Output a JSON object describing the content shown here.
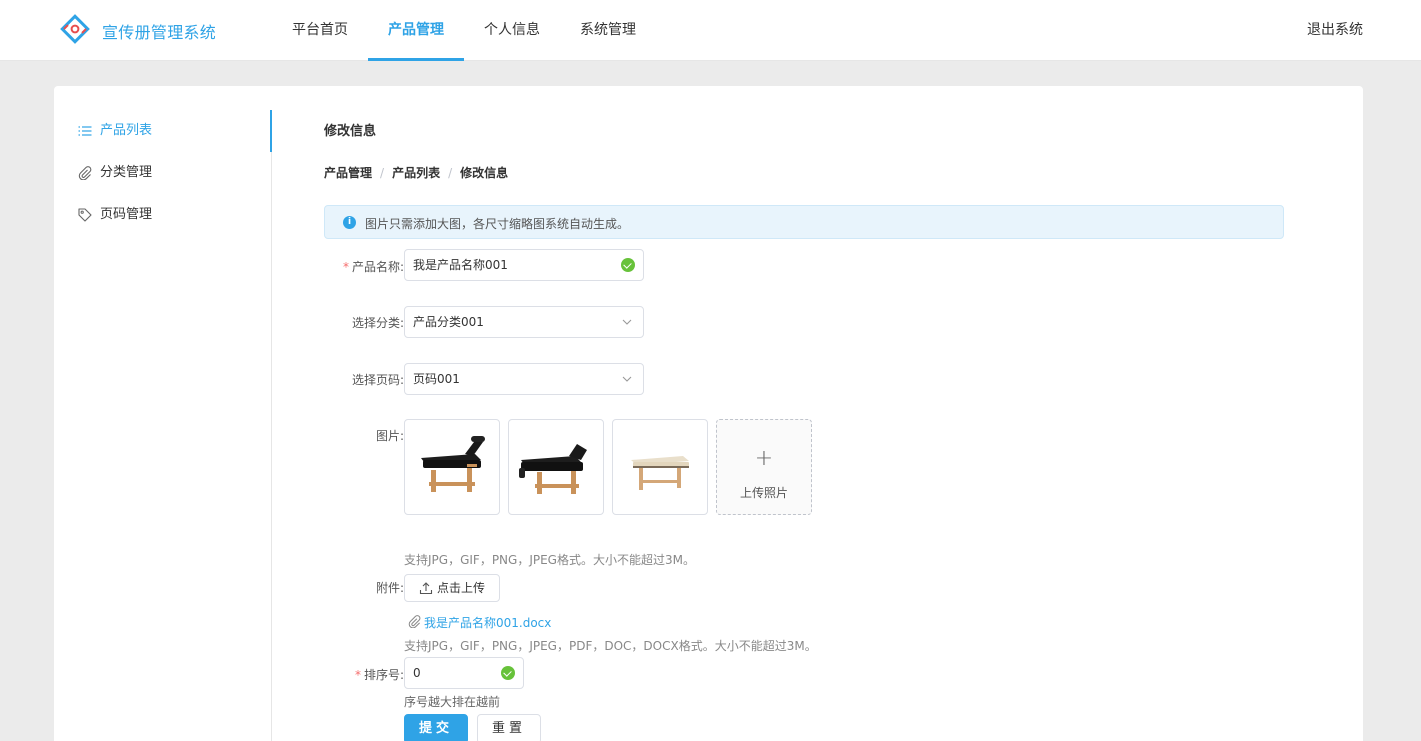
{
  "app": {
    "title": "宣传册管理系统",
    "logo_icon": "diamond-logo-icon",
    "accent": "#2fa3e6"
  },
  "nav": {
    "items": [
      {
        "label": "平台首页",
        "active": false
      },
      {
        "label": "产品管理",
        "active": true
      },
      {
        "label": "个人信息",
        "active": false
      },
      {
        "label": "系统管理",
        "active": false
      }
    ],
    "logout": "退出系统"
  },
  "sidebar": {
    "items": [
      {
        "label": "产品列表",
        "icon": "list-icon",
        "active": true
      },
      {
        "label": "分类管理",
        "icon": "paperclip-icon",
        "active": false
      },
      {
        "label": "页码管理",
        "icon": "tag-icon",
        "active": false
      }
    ]
  },
  "main": {
    "title": "修改信息",
    "breadcrumb": [
      "产品管理",
      "产品列表",
      "修改信息"
    ],
    "alert": "图片只需添加大图，各尺寸缩略图系统自动生成。"
  },
  "form": {
    "name": {
      "label": "产品名称:",
      "value": "我是产品名称001",
      "required": true
    },
    "category": {
      "label": "选择分类:",
      "value": "产品分类001"
    },
    "page": {
      "label": "选择页码:",
      "value": "页码001"
    },
    "images": {
      "label": "图片:",
      "upload_label": "上传照片",
      "hint": "支持JPG，GIF，PNG，JPEG格式。大小不能超过3M。"
    },
    "attachment": {
      "label": "附件:",
      "button": "点击上传",
      "file": "我是产品名称001.docx",
      "hint": "支持JPG，GIF，PNG，JPEG，PDF，DOC，DOCX格式。大小不能超过3M。"
    },
    "sort": {
      "label": "排序号:",
      "value": "0",
      "required": true,
      "hint": "序号越大排在越前"
    },
    "submit": "提交",
    "reset": "重置"
  }
}
